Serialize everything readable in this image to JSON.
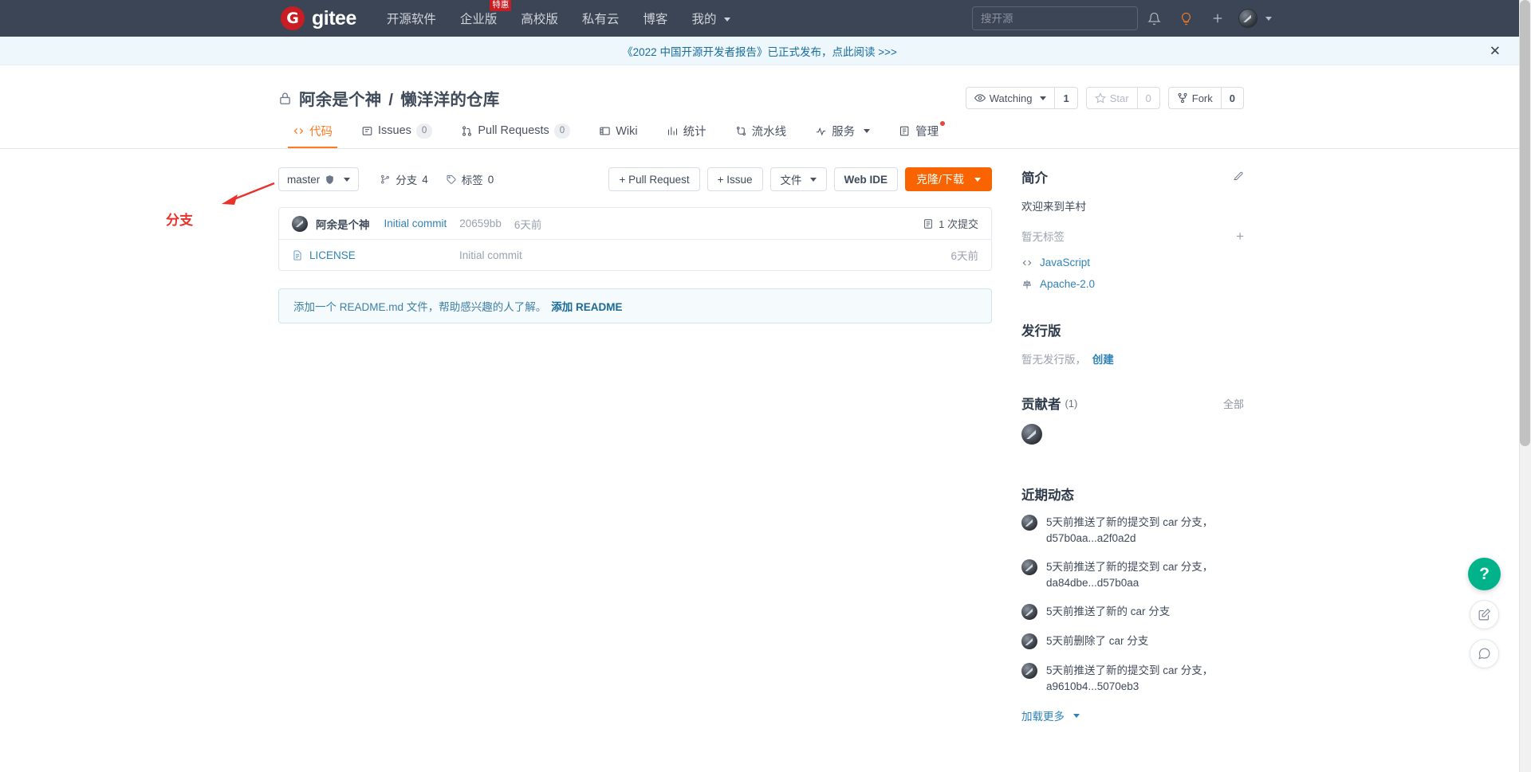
{
  "topnav": {
    "logo_text": "gitee",
    "logo_mark": "G",
    "links": [
      {
        "label": "开源软件",
        "badge": null
      },
      {
        "label": "企业版",
        "badge": "特惠"
      },
      {
        "label": "高校版",
        "badge": null
      },
      {
        "label": "私有云",
        "badge": null
      },
      {
        "label": "博客",
        "badge": null
      },
      {
        "label": "我的",
        "badge": null,
        "has_caret": true
      }
    ],
    "search_placeholder": "搜开源",
    "icons": [
      "bell-icon",
      "lightbulb-icon",
      "plus-icon",
      "avatar"
    ]
  },
  "banner": {
    "text": "《2022 中国开源开发者报告》已正式发布，点此阅读 >>>",
    "close": "✕"
  },
  "repo": {
    "owner": "阿余是个神",
    "separator": "/",
    "name": "懒洋洋的仓库",
    "visibility_icon": "lock-icon",
    "watch_label": "Watching",
    "watch_count": "1",
    "star_label": "Star",
    "star_count": "0",
    "fork_label": "Fork",
    "fork_count": "0"
  },
  "tabs": [
    {
      "label": "代码",
      "icon": "code-icon",
      "count": null,
      "active": true
    },
    {
      "label": "Issues",
      "icon": "issues-icon",
      "count": "0",
      "active": false
    },
    {
      "label": "Pull Requests",
      "icon": "pr-icon",
      "count": "0",
      "active": false
    },
    {
      "label": "Wiki",
      "icon": "wiki-icon",
      "count": null,
      "active": false
    },
    {
      "label": "统计",
      "icon": "stats-icon",
      "count": null,
      "active": false
    },
    {
      "label": "流水线",
      "icon": "pipeline-icon",
      "count": null,
      "active": false
    },
    {
      "label": "服务",
      "icon": "service-icon",
      "count": null,
      "active": false,
      "caret": true
    },
    {
      "label": "管理",
      "icon": "manage-icon",
      "count": null,
      "active": false,
      "dot": true
    }
  ],
  "toolbar": {
    "branch_name": "master",
    "branches_label": "分支",
    "branches_count": "4",
    "tags_label": "标签",
    "tags_count": "0",
    "pull_request_btn": "+ Pull Request",
    "issue_btn": "+ Issue",
    "files_btn": "文件",
    "webide_btn": "Web IDE",
    "clone_btn": "克隆/下载"
  },
  "commit_bar": {
    "author": "阿余是个神",
    "message": "Initial commit",
    "sha": "20659bb",
    "time": "6天前",
    "commit_count": "1 次提交"
  },
  "files": [
    {
      "name": "LICENSE",
      "icon": "file-icon",
      "commit": "Initial commit",
      "time": "6天前"
    }
  ],
  "readme_prompt": {
    "text": "添加一个 README.md 文件，帮助感兴趣的人了解。",
    "link": "添加 README"
  },
  "sidebar": {
    "intro": {
      "title": "简介",
      "edit_icon": "edit-icon",
      "description": "欢迎来到羊村",
      "tags_empty": "暂无标签",
      "add_tag": "+",
      "language": "JavaScript",
      "license": "Apache-2.0"
    },
    "releases": {
      "title": "发行版",
      "empty_text": "暂无发行版，",
      "create_link": "创建"
    },
    "contributors": {
      "title": "贡献者",
      "count": "(1)",
      "all_link": "全部",
      "avatars": 1
    },
    "activity": {
      "title": "近期动态",
      "items": [
        "5天前推送了新的提交到 car 分支，d57b0aa...a2f0a2d",
        "5天前推送了新的提交到 car 分支，da84dbe...d57b0aa",
        "5天前推送了新的 car 分支",
        "5天前删除了 car 分支",
        "5天前推送了新的提交到 car 分支，a9610b4...5070eb3"
      ],
      "load_more": "加载更多"
    }
  },
  "annotation": {
    "label": "分支",
    "color": "#e8322a"
  },
  "floating": {
    "help": "?",
    "feedback_icon": "edit-square-icon",
    "chat_icon": "chat-icon"
  },
  "colors": {
    "brand_orange": "#fa6400",
    "nav_bg": "#3c4555",
    "logo_red": "#c71d23",
    "link_blue": "#2f82b8"
  }
}
